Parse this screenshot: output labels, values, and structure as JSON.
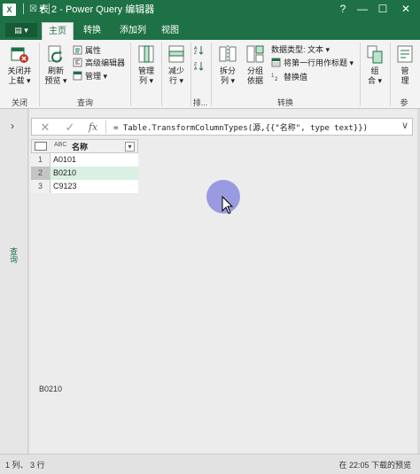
{
  "window": {
    "app_icon_letter": "X",
    "quick_access": "│ ☒ ▾ │",
    "title": "表 2 - Power Query 编辑器",
    "controls": {
      "help": "?",
      "minimize": "—",
      "maximize": "☐",
      "close": "✕"
    }
  },
  "ribbon_tabs": {
    "file_label": "▤ ▾",
    "tabs": [
      "主页",
      "转换",
      "添加列",
      "视图"
    ]
  },
  "ribbon": {
    "close_load": "关闭并\n上载 ▾",
    "refresh_preview": "刷新\n预览 ▾",
    "properties": "属性",
    "advanced_editor": "高级编辑器",
    "manage": "管理 ▾",
    "manage_columns": "管理\n列 ▾",
    "reduce_rows": "减少\n行 ▾",
    "split_column": "拆分\n列 ▾",
    "group_by": "分组\n依据",
    "data_type": "数据类型: 文本 ▾",
    "use_first_row": "将第一行用作标题 ▾",
    "replace_values": "替换值",
    "combine": "组\n合 ▾",
    "parameters_cut": "管\n理",
    "group_close": "关闭",
    "group_query": "查询",
    "group_sort": "排...",
    "group_transform": "转换",
    "group_params_cut": "参"
  },
  "query_pane": {
    "expand_label": "›",
    "vertical_label": "查询"
  },
  "formula_bar": {
    "cancel": "✕",
    "confirm": "✓",
    "fx": "fx",
    "formula": "= Table.TransformColumnTypes(源,{{\"名称\", type text}})",
    "expand": "∨"
  },
  "table": {
    "column_type_icon": "ABC",
    "column_header": "名称",
    "filter_icon": "▾",
    "rows": [
      {
        "num": "1",
        "value": "A0101"
      },
      {
        "num": "2",
        "value": "B0210"
      },
      {
        "num": "3",
        "value": "C9123"
      }
    ],
    "selected_row": 2
  },
  "preview_value": "B0210",
  "status": {
    "left": "1 列、 3 行",
    "right": "在 22:05 下载的预览"
  },
  "colors": {
    "accent": "#1e7145",
    "selection": "#d9f0e2",
    "cursor_halo": "#6e6edc"
  }
}
